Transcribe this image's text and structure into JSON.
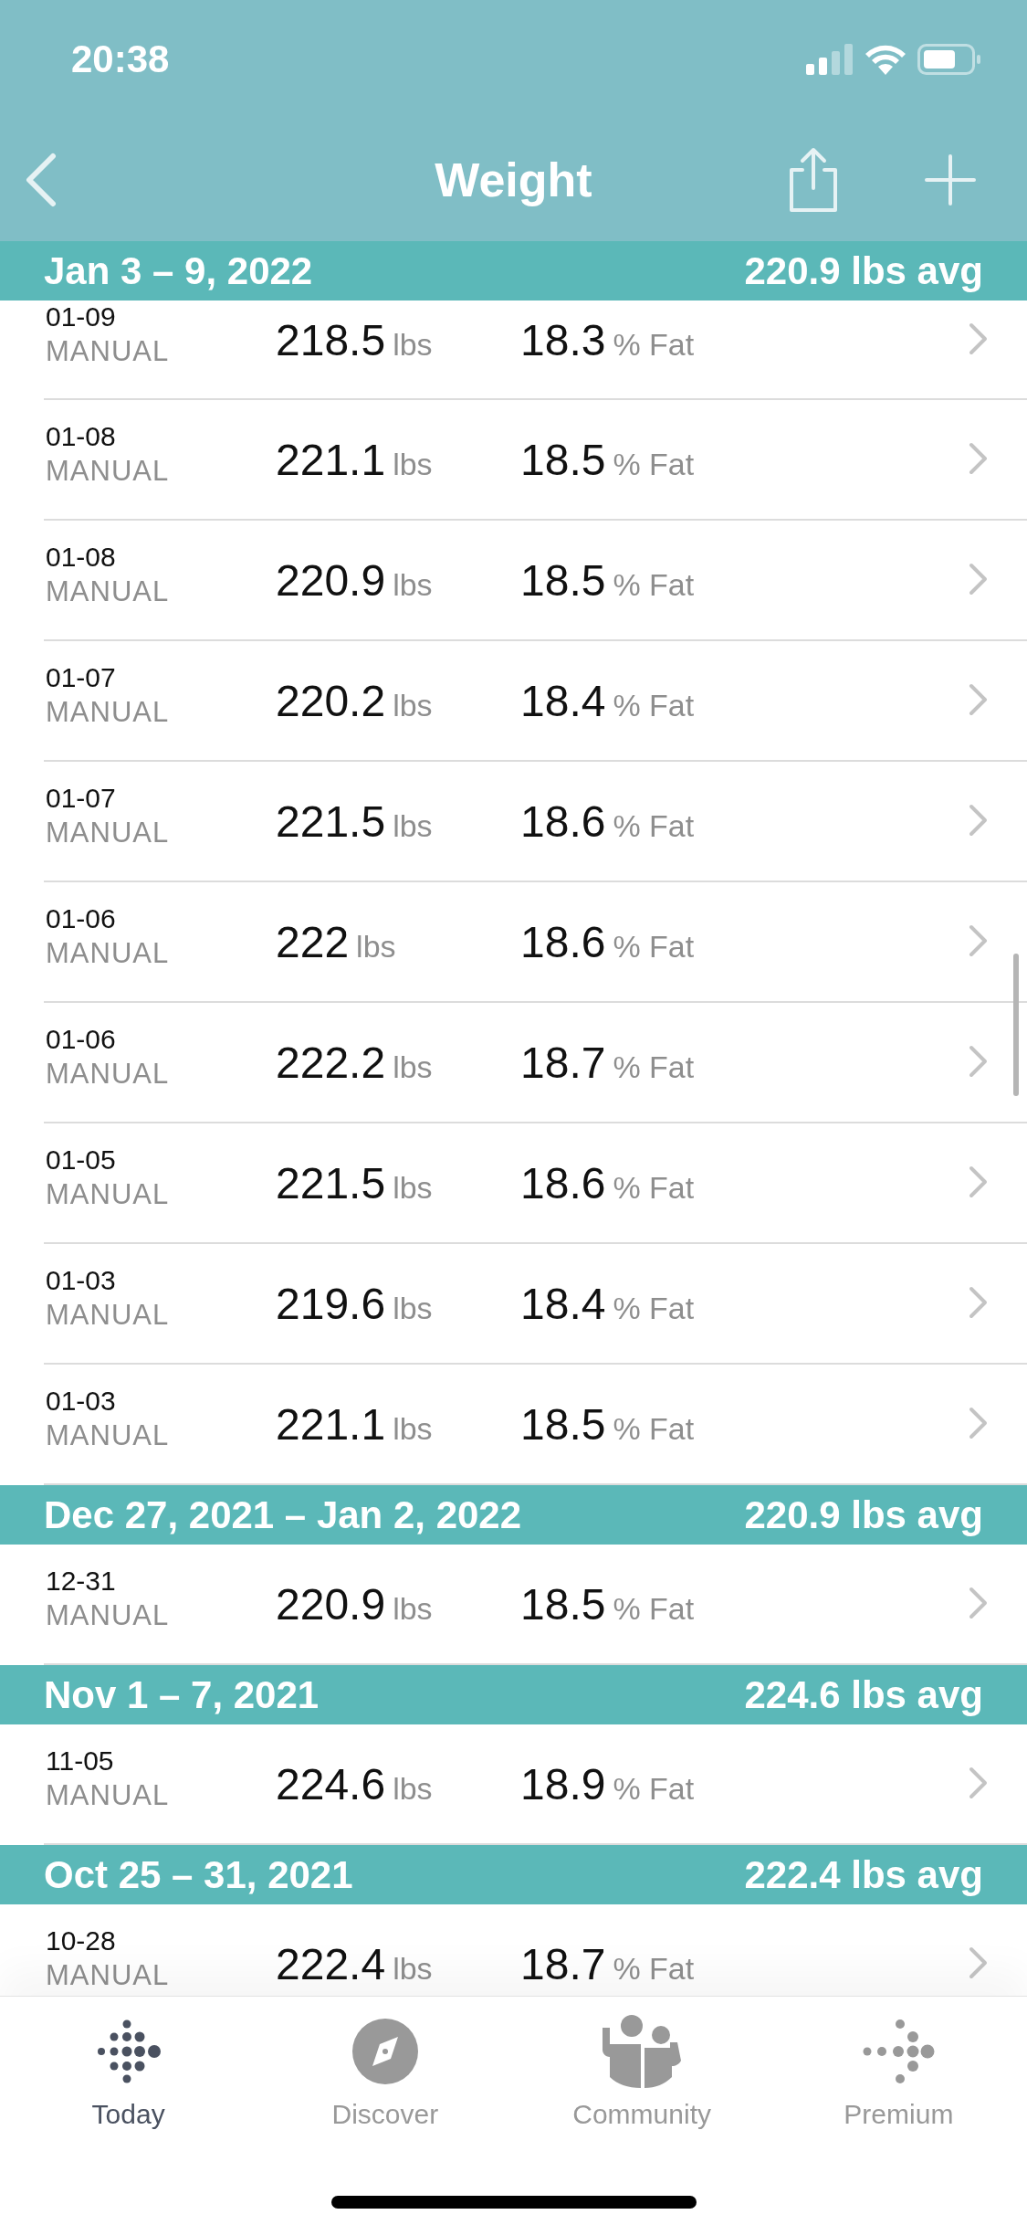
{
  "status_bar": {
    "time": "20:38"
  },
  "nav": {
    "title": "Weight"
  },
  "sections": [
    {
      "range": "Jan 3 – 9, 2022",
      "average": "220.9 lbs avg",
      "entries": [
        {
          "date": "01-09",
          "source": "MANUAL",
          "weight": "218.5",
          "weight_unit": "lbs",
          "fat": "18.3",
          "fat_unit": "% Fat"
        },
        {
          "date": "01-08",
          "source": "MANUAL",
          "weight": "221.1",
          "weight_unit": "lbs",
          "fat": "18.5",
          "fat_unit": "% Fat"
        },
        {
          "date": "01-08",
          "source": "MANUAL",
          "weight": "220.9",
          "weight_unit": "lbs",
          "fat": "18.5",
          "fat_unit": "% Fat"
        },
        {
          "date": "01-07",
          "source": "MANUAL",
          "weight": "220.2",
          "weight_unit": "lbs",
          "fat": "18.4",
          "fat_unit": "% Fat"
        },
        {
          "date": "01-07",
          "source": "MANUAL",
          "weight": "221.5",
          "weight_unit": "lbs",
          "fat": "18.6",
          "fat_unit": "% Fat"
        },
        {
          "date": "01-06",
          "source": "MANUAL",
          "weight": "222",
          "weight_unit": "lbs",
          "fat": "18.6",
          "fat_unit": "% Fat"
        },
        {
          "date": "01-06",
          "source": "MANUAL",
          "weight": "222.2",
          "weight_unit": "lbs",
          "fat": "18.7",
          "fat_unit": "% Fat"
        },
        {
          "date": "01-05",
          "source": "MANUAL",
          "weight": "221.5",
          "weight_unit": "lbs",
          "fat": "18.6",
          "fat_unit": "% Fat"
        },
        {
          "date": "01-03",
          "source": "MANUAL",
          "weight": "219.6",
          "weight_unit": "lbs",
          "fat": "18.4",
          "fat_unit": "% Fat"
        },
        {
          "date": "01-03",
          "source": "MANUAL",
          "weight": "221.1",
          "weight_unit": "lbs",
          "fat": "18.5",
          "fat_unit": "% Fat"
        }
      ]
    },
    {
      "range": "Dec 27, 2021 – Jan 2, 2022",
      "average": "220.9 lbs avg",
      "entries": [
        {
          "date": "12-31",
          "source": "MANUAL",
          "weight": "220.9",
          "weight_unit": "lbs",
          "fat": "18.5",
          "fat_unit": "% Fat"
        }
      ]
    },
    {
      "range": "Nov 1 – 7, 2021",
      "average": "224.6 lbs avg",
      "entries": [
        {
          "date": "11-05",
          "source": "MANUAL",
          "weight": "224.6",
          "weight_unit": "lbs",
          "fat": "18.9",
          "fat_unit": "% Fat"
        }
      ]
    },
    {
      "range": "Oct 25 – 31, 2021",
      "average": "222.4 lbs avg",
      "entries": [
        {
          "date": "10-28",
          "source": "MANUAL",
          "weight": "222.4",
          "weight_unit": "lbs",
          "fat": "18.7",
          "fat_unit": "% Fat"
        }
      ]
    }
  ],
  "tabs": [
    {
      "label": "Today",
      "selected": true
    },
    {
      "label": "Discover",
      "selected": false
    },
    {
      "label": "Community",
      "selected": false
    },
    {
      "label": "Premium",
      "selected": false
    }
  ]
}
